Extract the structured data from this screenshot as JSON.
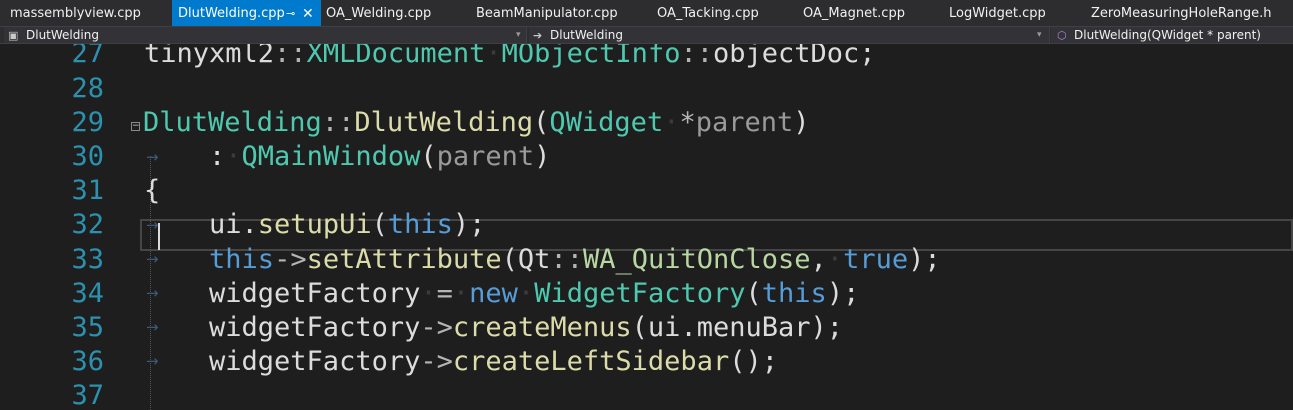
{
  "tabs": [
    {
      "label": "massemblyview.cpp",
      "active": false
    },
    {
      "label": "DlutWelding.cpp",
      "active": true
    },
    {
      "label": "OA_Welding.cpp",
      "active": false
    },
    {
      "label": "BeamManipulator.cpp",
      "active": false
    },
    {
      "label": "OA_Tacking.cpp",
      "active": false
    },
    {
      "label": "OA_Magnet.cpp",
      "active": false
    },
    {
      "label": "LogWidget.cpp",
      "active": false
    },
    {
      "label": "ZeroMeasuringHoleRange.h",
      "active": false
    }
  ],
  "tab_icons": {
    "pin": "⊸",
    "close": "✕"
  },
  "nav": {
    "project": "DlutWelding",
    "scope": "DlutWelding",
    "member": "DlutWelding(QWidget * parent)"
  },
  "nav_icons": {
    "project": "▣",
    "scope": "➔",
    "member": "⬡",
    "dropdown": "▾"
  },
  "gutter": {
    "fold_collapse": "−",
    "indent_arrow": "→"
  },
  "lines": [
    {
      "num": "27",
      "tokens": [
        {
          "t": "tinyxml2",
          "c": "#dcdcdc"
        },
        {
          "t": "::",
          "c": "#b4b4b4"
        },
        {
          "t": "XMLDocument",
          "c": "#4ec9b0"
        },
        {
          "t": "·",
          "c": "#3b3b3b"
        },
        {
          "t": "MObjectInfo",
          "c": "#4ec9b0"
        },
        {
          "t": "::",
          "c": "#b4b4b4"
        },
        {
          "t": "objectDoc;",
          "c": "#dcdcdc"
        }
      ]
    },
    {
      "num": "28",
      "tokens": []
    },
    {
      "num": "29",
      "tokens": [
        {
          "t": "DlutWelding",
          "c": "#4ec9b0"
        },
        {
          "t": "::",
          "c": "#b4b4b4"
        },
        {
          "t": "DlutWelding",
          "c": "#dcdcaa"
        },
        {
          "t": "(",
          "c": "#dcdcdc"
        },
        {
          "t": "QWidget",
          "c": "#4ec9b0"
        },
        {
          "t": "·",
          "c": "#3b3b3b"
        },
        {
          "t": "*",
          "c": "#b4b4b4"
        },
        {
          "t": "parent",
          "c": "#9a9a9a"
        },
        {
          "t": ")",
          "c": "#dcdcdc"
        }
      ]
    },
    {
      "num": "30",
      "tokens": [
        {
          "t": "    :",
          "c": "#dcdcdc"
        },
        {
          "t": "·",
          "c": "#3b3b3b"
        },
        {
          "t": "QMainWindow",
          "c": "#4ec9b0"
        },
        {
          "t": "(",
          "c": "#dcdcdc"
        },
        {
          "t": "parent",
          "c": "#9a9a9a"
        },
        {
          "t": ")",
          "c": "#dcdcdc"
        }
      ]
    },
    {
      "num": "31",
      "tokens": [
        {
          "t": "{",
          "c": "#dcdcdc"
        }
      ]
    },
    {
      "num": "32",
      "tokens": [
        {
          "t": "    ui.",
          "c": "#dcdcdc"
        },
        {
          "t": "setupUi",
          "c": "#dcdcaa"
        },
        {
          "t": "(",
          "c": "#dcdcdc"
        },
        {
          "t": "this",
          "c": "#569cd6"
        },
        {
          "t": ");",
          "c": "#dcdcdc"
        }
      ]
    },
    {
      "num": "33",
      "tokens": [
        {
          "t": "    ",
          "c": "#dcdcdc"
        },
        {
          "t": "this",
          "c": "#569cd6"
        },
        {
          "t": "->",
          "c": "#b4b4b4"
        },
        {
          "t": "setAttribute",
          "c": "#dcdcaa"
        },
        {
          "t": "(Qt",
          "c": "#dcdcdc"
        },
        {
          "t": "::",
          "c": "#b4b4b4"
        },
        {
          "t": "WA_QuitOnClose",
          "c": "#b8d7a3"
        },
        {
          "t": ",",
          "c": "#dcdcdc"
        },
        {
          "t": "·",
          "c": "#3b3b3b"
        },
        {
          "t": "true",
          "c": "#569cd6"
        },
        {
          "t": ");",
          "c": "#dcdcdc"
        }
      ]
    },
    {
      "num": "34",
      "tokens": [
        {
          "t": "    widgetFactory",
          "c": "#dcdcdc"
        },
        {
          "t": "·",
          "c": "#3b3b3b"
        },
        {
          "t": "=",
          "c": "#b4b4b4"
        },
        {
          "t": "·",
          "c": "#3b3b3b"
        },
        {
          "t": "new",
          "c": "#569cd6"
        },
        {
          "t": "·",
          "c": "#3b3b3b"
        },
        {
          "t": "WidgetFactory",
          "c": "#4ec9b0"
        },
        {
          "t": "(",
          "c": "#dcdcdc"
        },
        {
          "t": "this",
          "c": "#569cd6"
        },
        {
          "t": ");",
          "c": "#dcdcdc"
        }
      ]
    },
    {
      "num": "35",
      "tokens": [
        {
          "t": "    widgetFactory",
          "c": "#dcdcdc"
        },
        {
          "t": "->",
          "c": "#b4b4b4"
        },
        {
          "t": "createMenus",
          "c": "#dcdcaa"
        },
        {
          "t": "(ui.menuBar);",
          "c": "#dcdcdc"
        }
      ]
    },
    {
      "num": "36",
      "tokens": [
        {
          "t": "    widgetFactory",
          "c": "#dcdcdc"
        },
        {
          "t": "->",
          "c": "#b4b4b4"
        },
        {
          "t": "createLeftSidebar",
          "c": "#dcdcaa"
        },
        {
          "t": "();",
          "c": "#dcdcdc"
        }
      ]
    },
    {
      "num": "37",
      "tokens": []
    }
  ]
}
